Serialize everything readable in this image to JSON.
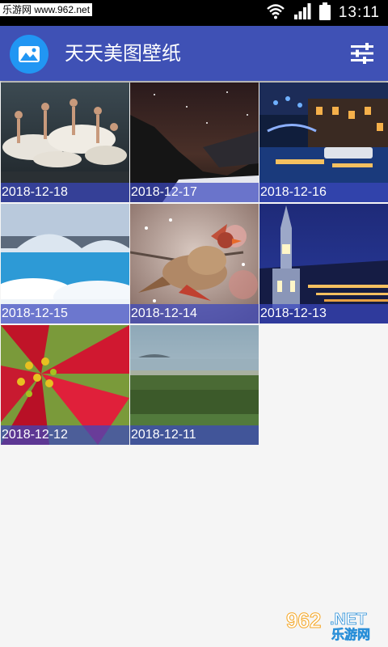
{
  "status_bar": {
    "watermark_text": "乐游网 www.962.net",
    "time": "13:11",
    "icons": [
      "wifi-icon",
      "signal-icon",
      "battery-icon"
    ]
  },
  "app_bar": {
    "title": "天天美图壁纸",
    "logo_icon": "mountain-photo-icon",
    "settings_icon": "sliders-icon",
    "color": "#3f51b5"
  },
  "wallpapers": [
    {
      "date": "2018-12-18",
      "subject": "ballet dancers on stage"
    },
    {
      "date": "2018-12-17",
      "subject": "night sky over snowy mountains"
    },
    {
      "date": "2018-12-16",
      "subject": "canal with holiday lights at night"
    },
    {
      "date": "2018-12-15",
      "subject": "snowy stone bridge over river"
    },
    {
      "date": "2018-12-14",
      "subject": "cardinal bird on snowy branch"
    },
    {
      "date": "2018-12-13",
      "subject": "church tower and city lights at dusk"
    },
    {
      "date": "2018-12-12",
      "subject": "red poinsettia flower"
    },
    {
      "date": "2018-12-11",
      "subject": "green landscape with sea horizon"
    }
  ],
  "bottom_watermark": {
    "number": "962",
    "suffix": ".NET",
    "text": "乐游网"
  }
}
